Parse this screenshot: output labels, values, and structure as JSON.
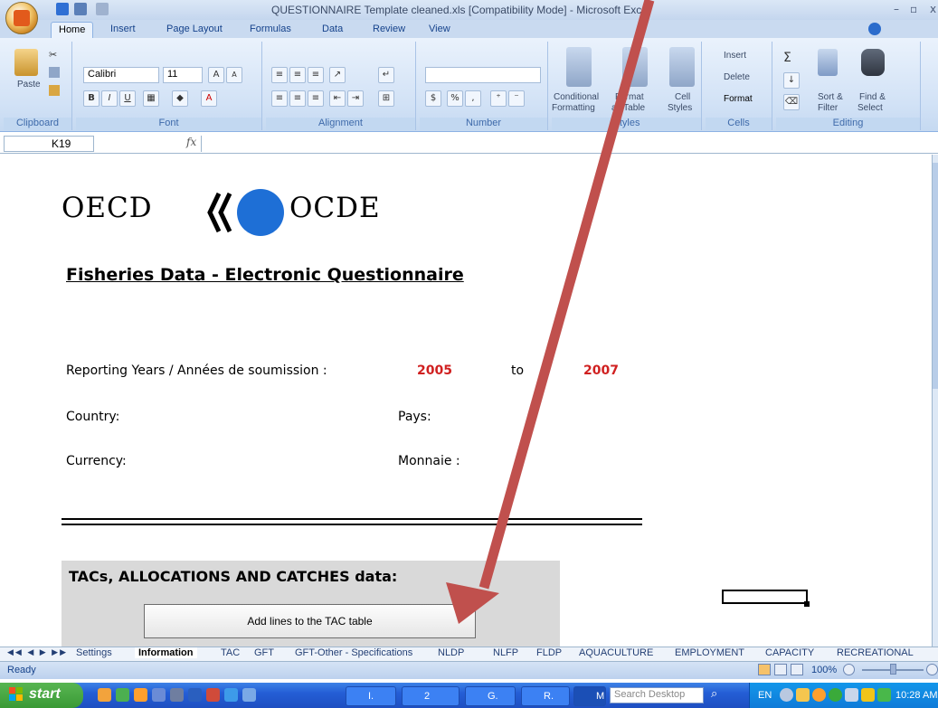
{
  "window": {
    "title": "QUESTIONNAIRE Template cleaned.xls  [Compatibility Mode] - Microsoft Excel",
    "minimize": "–",
    "restore": "▫",
    "close": "x"
  },
  "ribbon_tabs": [
    "Home",
    "Insert",
    "Page Layout",
    "Formulas",
    "Data",
    "Review",
    "View"
  ],
  "ribbon": {
    "clipboard": {
      "label": "Clipboard",
      "paste": "Paste"
    },
    "font": {
      "label": "Font",
      "name": "Calibri",
      "size": "11",
      "bold": "B",
      "italic": "I",
      "underline": "U",
      "grow": "A",
      "shrink": "A"
    },
    "alignment": {
      "label": "Alignment"
    },
    "number": {
      "label": "Number",
      "percent": "%",
      "comma": ","
    },
    "styles": {
      "label": "Styles",
      "conditional": "Conditional",
      "formatting": "Formatting",
      "format_as": "Format",
      "as_table": "as Table",
      "cell": "Cell",
      "cell_styles": "Styles"
    },
    "cells": {
      "label": "Cells",
      "insert": "Insert",
      "delete": "Delete",
      "format": "Format"
    },
    "editing": {
      "label": "Editing",
      "sort": "Sort &",
      "filter": "Filter",
      "find": "Find &",
      "select": "Select"
    }
  },
  "formula_bar": {
    "name_box": "K19",
    "fx": "fx",
    "value": ""
  },
  "sheet": {
    "logo_left": "OECD",
    "logo_right": "OCDE",
    "title": "Fisheries Data - Electronic Questionnaire",
    "reporting_label": "Reporting Years / Années de soumission :",
    "year_from": "2005",
    "to_label": "to",
    "year_to": "2007",
    "country_label": "Country:",
    "pays_label": "Pays:",
    "currency_label": "Currency:",
    "monnaie_label": "Monnaie :",
    "tac_heading": "TACs, ALLOCATIONS AND CATCHES data:",
    "tac_button": "Add lines to the TAC table"
  },
  "sheet_tabs": [
    "Settings",
    "Information",
    "TAC",
    "GFT",
    "GFT-Other - Specifications",
    "NLDP",
    "NLFP",
    "FLDP",
    "AQUACULTURE",
    "EMPLOYMENT",
    "CAPACITY",
    "RECREATIONAL"
  ],
  "status": {
    "text": "Ready",
    "zoom": "100%"
  },
  "taskbar": {
    "start": "start",
    "buttons": [
      "I.",
      "2",
      "G.",
      "R.",
      "M"
    ],
    "search_placeholder": "Search Desktop",
    "lang": "EN",
    "clock": "10:28 AM"
  },
  "colors": {
    "accent": "#c0504d",
    "year": "#d02020",
    "ribbon": "#d2e2f6"
  }
}
